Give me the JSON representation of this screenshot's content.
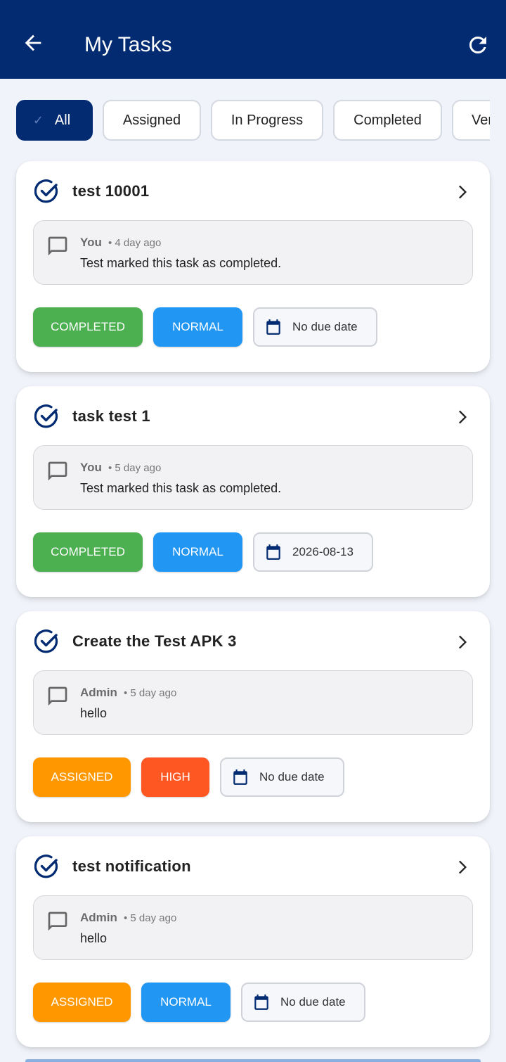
{
  "appbar": {
    "title": "My Tasks",
    "back_icon": "arrow-left-icon",
    "refresh_icon": "refresh-icon"
  },
  "filters": [
    {
      "label": "All",
      "active": true
    },
    {
      "label": "Assigned",
      "active": false
    },
    {
      "label": "In Progress",
      "active": false
    },
    {
      "label": "Completed",
      "active": false
    },
    {
      "label": "Ver",
      "active": false
    }
  ],
  "tasks": [
    {
      "title": "test 10001",
      "comment": {
        "author": "You",
        "time": "• 4 day ago",
        "text": "Test marked this task as completed."
      },
      "status": "COMPLETED",
      "priority": "NORMAL",
      "due": "No due date"
    },
    {
      "title": "task test 1",
      "comment": {
        "author": "You",
        "time": "• 5 day ago",
        "text": "Test marked this task as completed."
      },
      "status": "COMPLETED",
      "priority": "NORMAL",
      "due": "2026-08-13"
    },
    {
      "title": "Create the Test APK 3",
      "comment": {
        "author": "Admin",
        "time": "• 5 day ago",
        "text": "hello"
      },
      "status": "ASSIGNED",
      "priority": "HIGH",
      "due": "No due date"
    },
    {
      "title": "test notification",
      "comment": {
        "author": "Admin",
        "time": "• 5 day ago",
        "text": "hello"
      },
      "status": "ASSIGNED",
      "priority": "NORMAL",
      "due": "No due date"
    }
  ],
  "colors": {
    "appbar": "#022b72",
    "completed": "#4caf50",
    "assigned": "#ff9800",
    "normal": "#2196f3",
    "high": "#ff5722"
  }
}
